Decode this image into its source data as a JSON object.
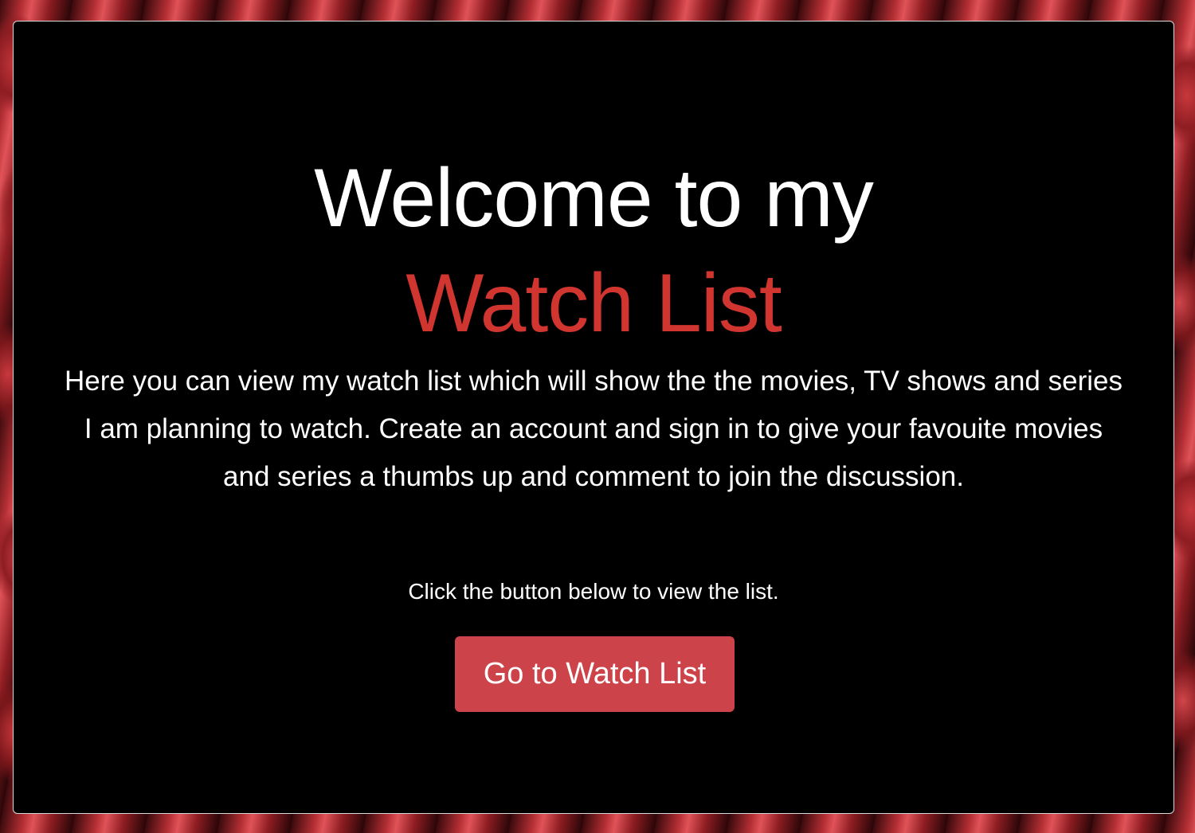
{
  "hero": {
    "title_line1": "Welcome to my",
    "title_line2": "Watch List",
    "intro": "Here you can view my watch list which will show the the movies, TV shows and series I am planning to watch. Create an account and sign in to give your favouite movies and series a thumbs up and comment to join the discussion.",
    "instruction": "Click the button below to view the list.",
    "button_label": "Go to Watch List"
  },
  "colors": {
    "accent": "#d0352f",
    "button": "#cc434a",
    "panel_background": "#000000",
    "text": "#ffffff"
  }
}
